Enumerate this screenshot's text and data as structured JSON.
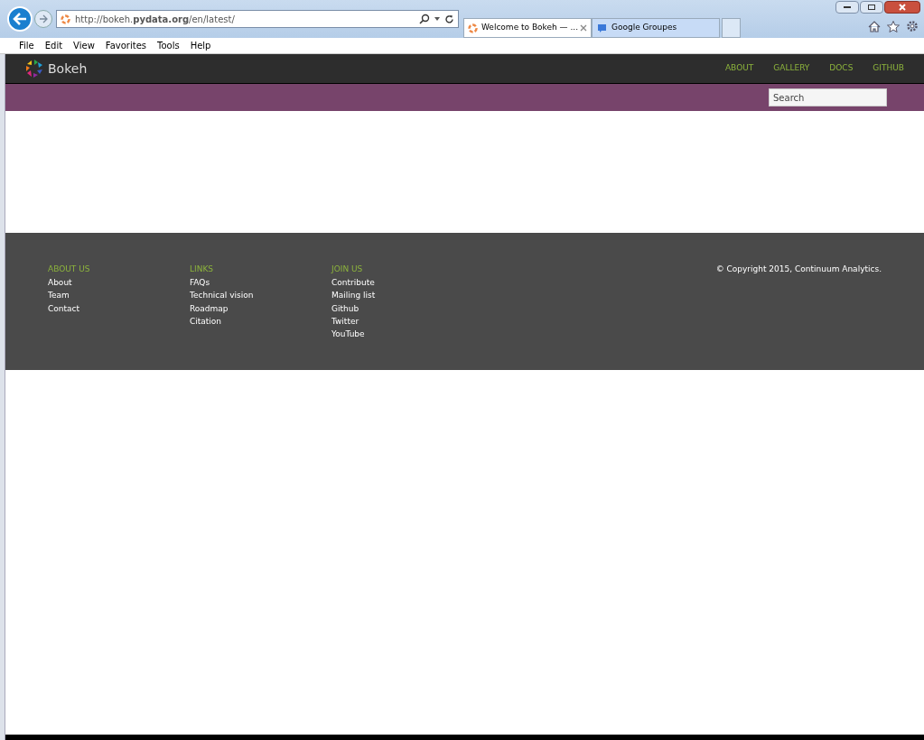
{
  "browser": {
    "address": "http://bokeh.**pydata.org**/en/latest/",
    "tabs": [
      {
        "label": "Welcome to Bokeh — ...",
        "selected": true,
        "closable": true
      },
      {
        "label": "Google Groupes",
        "selected": false,
        "closable": false
      }
    ],
    "menu": [
      "File",
      "Edit",
      "View",
      "Favorites",
      "Tools",
      "Help"
    ]
  },
  "site": {
    "brand": "Bokeh",
    "nav": [
      "ABOUT",
      "GALLERY",
      "DOCS",
      "GITHUB"
    ],
    "search": {
      "placeholder": "Search"
    },
    "footer": {
      "columns": [
        {
          "heading": "ABOUT US",
          "links": [
            "About",
            "Team",
            "Contact"
          ]
        },
        {
          "heading": "LINKS",
          "links": [
            "FAQs",
            "Technical vision",
            "Roadmap",
            "Citation"
          ]
        },
        {
          "heading": "JOIN US",
          "links": [
            "Contribute",
            "Mailing list",
            "Github",
            "Twitter",
            "YouTube"
          ]
        }
      ],
      "copyright": "© Copyright 2015, Continuum Analytics."
    }
  }
}
